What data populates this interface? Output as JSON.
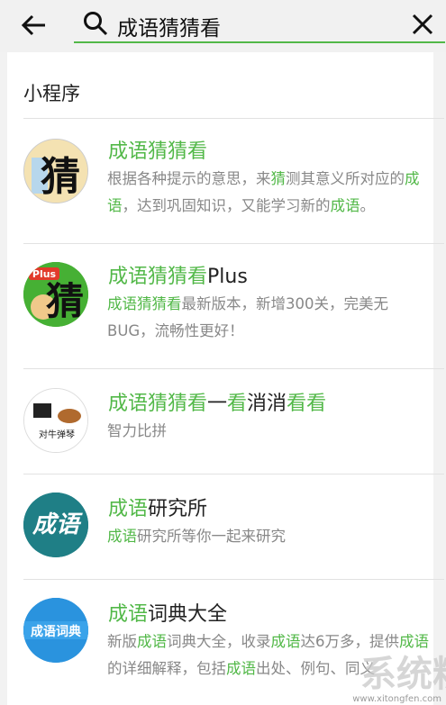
{
  "search": {
    "query": "成语猜猜看",
    "accent_color": "#52b848"
  },
  "icons": {
    "back": "arrow-left-icon",
    "search": "search-icon",
    "clear": "close-icon"
  },
  "section": {
    "title": "小程序"
  },
  "items": [
    {
      "title_parts": [
        "成语猜猜看"
      ],
      "desc_parts": [
        "根据各种提示的意思，来",
        "猜",
        "测其意义所对应的",
        "成语",
        "，达到巩固知识，又能学习新的",
        "成语",
        "。"
      ]
    },
    {
      "title_parts": [
        "成语猜猜看",
        "Plus"
      ],
      "desc_parts": [
        "成语猜猜看",
        "最新版本，新增300关，完美无BUG，流畅性更好！"
      ]
    },
    {
      "title_parts": [
        "成语猜猜看",
        "一",
        "看",
        "消消",
        "看看"
      ],
      "desc_parts": [
        "智力比拼"
      ]
    },
    {
      "title_parts": [
        "成语",
        "研究所"
      ],
      "desc_parts": [
        "成语",
        "研究所等你一起来研究"
      ]
    },
    {
      "title_parts": [
        "成语",
        "词典大全"
      ],
      "desc_parts": [
        "新版",
        "成语",
        "词典大全，收录",
        "成语",
        "达6万多，提供",
        "成语",
        "的详细解释，包括",
        "成语",
        "出处、例句、同义"
      ]
    }
  ],
  "avatar_text": {
    "item0": "猜",
    "item1_badge": "Plus",
    "item1_char": "猜",
    "item2": "对牛弹琴",
    "item3": "成语",
    "item4": "成语词典"
  },
  "watermark": {
    "text": "系统粉",
    "url": "www.xitongfen.com"
  }
}
